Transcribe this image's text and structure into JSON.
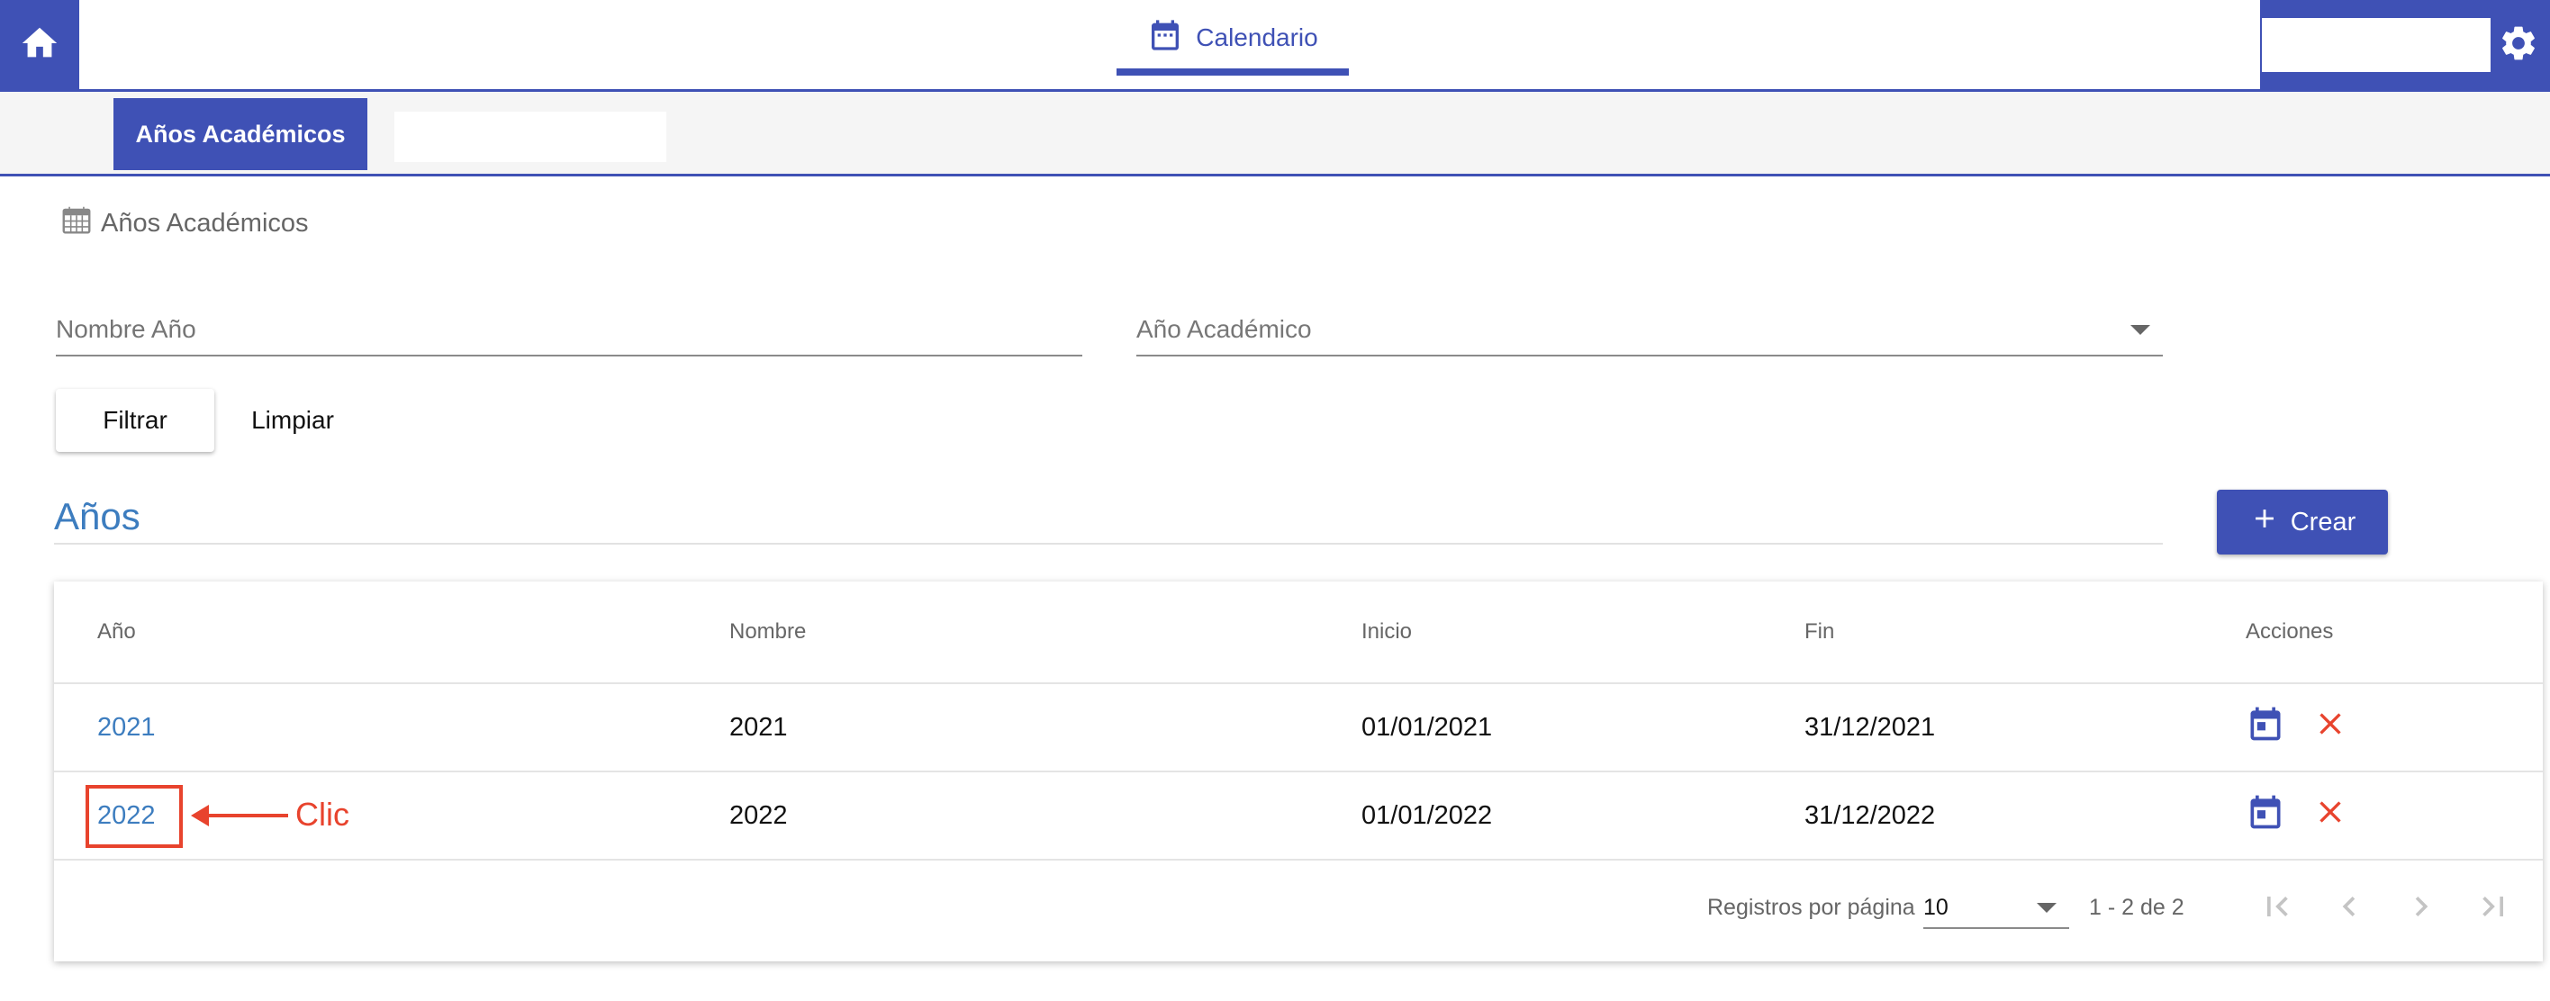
{
  "header": {
    "tab_label": "Calendario",
    "icons": {
      "home": "home-icon",
      "tab": "calendar-icon",
      "settings": "gear-icon"
    }
  },
  "subnav": {
    "active_tab": "Años Académicos"
  },
  "breadcrumb": {
    "label": "Años Académicos",
    "icon": "calendar-grid-icon"
  },
  "filters": {
    "name_placeholder": "Nombre Año",
    "year_placeholder": "Año Académico",
    "filter_button": "Filtrar",
    "clear_button": "Limpiar"
  },
  "section": {
    "title": "Años",
    "create_button": "Crear"
  },
  "table": {
    "columns": [
      "Año",
      "Nombre",
      "Inicio",
      "Fin",
      "Acciones"
    ],
    "rows": [
      {
        "ano": "2021",
        "nombre": "2021",
        "inicio": "01/01/2021",
        "fin": "31/12/2021"
      },
      {
        "ano": "2022",
        "nombre": "2022",
        "inicio": "01/01/2022",
        "fin": "31/12/2022"
      }
    ]
  },
  "annotation": {
    "label": "Clic",
    "color": "#e8432d"
  },
  "pagination": {
    "per_page_label": "Registros por página",
    "per_page_value": "10",
    "range": "1 - 2 de 2"
  },
  "colors": {
    "primary": "#3f51b5",
    "link": "#3d7dbf",
    "delete": "#e8432d"
  }
}
